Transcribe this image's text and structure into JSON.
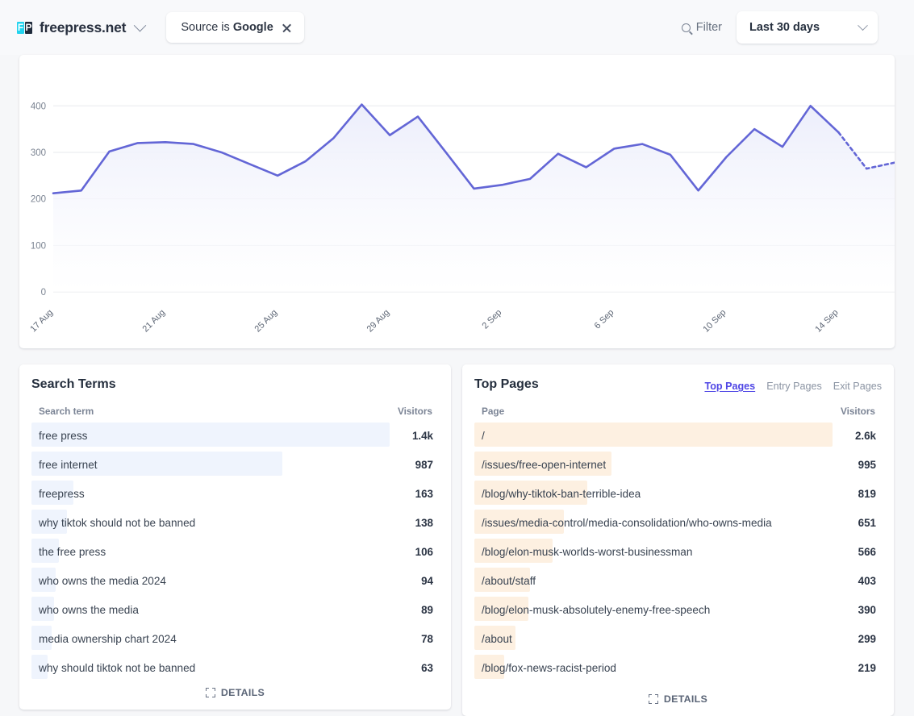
{
  "header": {
    "logo_f": "F",
    "logo_p": "P",
    "site_name": "freepress.net",
    "filter_pill": {
      "prefix": "Source is",
      "value": "Google"
    },
    "filter_button": "Filter",
    "period": "Last 30 days"
  },
  "chart_data": {
    "type": "area",
    "title": "",
    "xlabel": "",
    "ylabel": "",
    "ylim": [
      0,
      430
    ],
    "yticks": [
      0,
      100,
      200,
      300,
      400
    ],
    "ytick_labels": [
      "0",
      "100",
      "200",
      "300",
      "400"
    ],
    "xtick_labels": [
      "17 Aug",
      "21 Aug",
      "25 Aug",
      "29 Aug",
      "2 Sep",
      "6 Sep",
      "10 Sep",
      "14 Sep"
    ],
    "xtick_indices": [
      0,
      4,
      8,
      12,
      16,
      20,
      24,
      28
    ],
    "grid": true,
    "legend": "none",
    "line_color": "#6366d6",
    "fill_color": "#eceefb",
    "dashed_tail_points": 2,
    "x": [
      "17 Aug",
      "18 Aug",
      "19 Aug",
      "20 Aug",
      "21 Aug",
      "22 Aug",
      "23 Aug",
      "24 Aug",
      "25 Aug",
      "26 Aug",
      "27 Aug",
      "28 Aug",
      "29 Aug",
      "30 Aug",
      "31 Aug",
      "1 Sep",
      "2 Sep",
      "3 Sep",
      "4 Sep",
      "5 Sep",
      "6 Sep",
      "7 Sep",
      "8 Sep",
      "9 Sep",
      "10 Sep",
      "11 Sep",
      "12 Sep",
      "13 Sep",
      "14 Sep",
      "15 Sep",
      "16 Sep"
    ],
    "values": [
      212,
      218,
      302,
      320,
      322,
      318,
      300,
      275,
      250,
      281,
      331,
      403,
      337,
      377,
      300,
      222,
      230,
      243,
      297,
      268,
      308,
      318,
      295,
      218,
      290,
      350,
      312,
      400,
      343,
      265,
      278
    ]
  },
  "search_terms": {
    "title": "Search Terms",
    "columns": {
      "label": "Search term",
      "value": "Visitors"
    },
    "rows": [
      {
        "term": "free press",
        "visitors": "1.4k",
        "weight": 100
      },
      {
        "term": "free internet",
        "visitors": "987",
        "weight": 70
      },
      {
        "term": "freepress",
        "visitors": "163",
        "weight": 11.6
      },
      {
        "term": "why tiktok should not be banned",
        "visitors": "138",
        "weight": 9.8
      },
      {
        "term": "the free press",
        "visitors": "106",
        "weight": 7.6
      },
      {
        "term": "who owns the media 2024",
        "visitors": "94",
        "weight": 6.7
      },
      {
        "term": "who owns the media",
        "visitors": "89",
        "weight": 6.4
      },
      {
        "term": "media ownership chart 2024",
        "visitors": "78",
        "weight": 5.6
      },
      {
        "term": "why should tiktok not be banned",
        "visitors": "63",
        "weight": 4.5
      }
    ],
    "details": "DETAILS"
  },
  "top_pages": {
    "title": "Top Pages",
    "tabs": [
      {
        "label": "Top Pages",
        "active": true
      },
      {
        "label": "Entry Pages",
        "active": false
      },
      {
        "label": "Exit Pages",
        "active": false
      }
    ],
    "columns": {
      "label": "Page",
      "value": "Visitors"
    },
    "rows": [
      {
        "page": "/",
        "visitors": "2.6k",
        "weight": 100
      },
      {
        "page": "/issues/free-open-internet",
        "visitors": "995",
        "weight": 38.3
      },
      {
        "page": "/blog/why-tiktok-ban-terrible-idea",
        "visitors": "819",
        "weight": 31.5
      },
      {
        "page": "/issues/media-control/media-consolidation/who-owns-media",
        "visitors": "651",
        "weight": 25.0
      },
      {
        "page": "/blog/elon-musk-worlds-worst-businessman",
        "visitors": "566",
        "weight": 21.8
      },
      {
        "page": "/about/staff",
        "visitors": "403",
        "weight": 15.5
      },
      {
        "page": "/blog/elon-musk-absolutely-enemy-free-speech",
        "visitors": "390",
        "weight": 15.0
      },
      {
        "page": "/about",
        "visitors": "299",
        "weight": 11.5
      },
      {
        "page": "/blog/fox-news-racist-period",
        "visitors": "219",
        "weight": 8.4
      }
    ],
    "details": "DETAILS"
  }
}
